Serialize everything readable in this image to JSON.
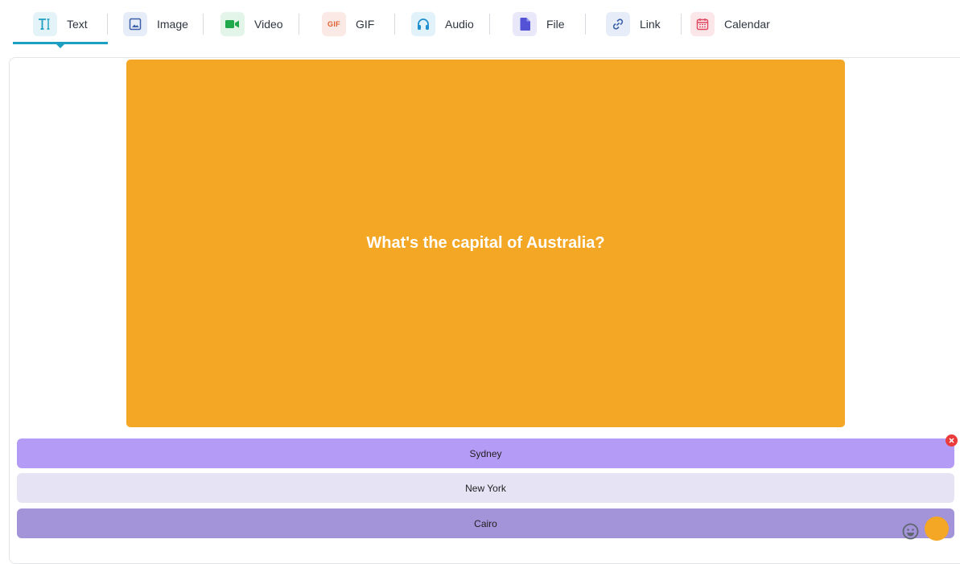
{
  "tabs": [
    {
      "label": "Text",
      "icon": "text-icon",
      "active": true
    },
    {
      "label": "Image",
      "icon": "image-icon"
    },
    {
      "label": "Video",
      "icon": "video-icon"
    },
    {
      "label": "GIF",
      "icon": "gif-icon"
    },
    {
      "label": "Audio",
      "icon": "headphones-icon"
    },
    {
      "label": "File",
      "icon": "file-icon"
    },
    {
      "label": "Link",
      "icon": "link-icon"
    },
    {
      "label": "Calendar",
      "icon": "calendar-icon"
    }
  ],
  "gif_icon_text": "GIF",
  "question": {
    "text": "What's the capital of Australia?",
    "background": "#f3a724"
  },
  "options": [
    {
      "label": "Sydney",
      "color": "#b49cf6"
    },
    {
      "label": "New York",
      "color": "#e6e3f4"
    },
    {
      "label": "Cairo",
      "color": "#a393d8"
    }
  ],
  "colors": {
    "accent": "#1c9fc0",
    "remove": "#ea3b3b"
  }
}
